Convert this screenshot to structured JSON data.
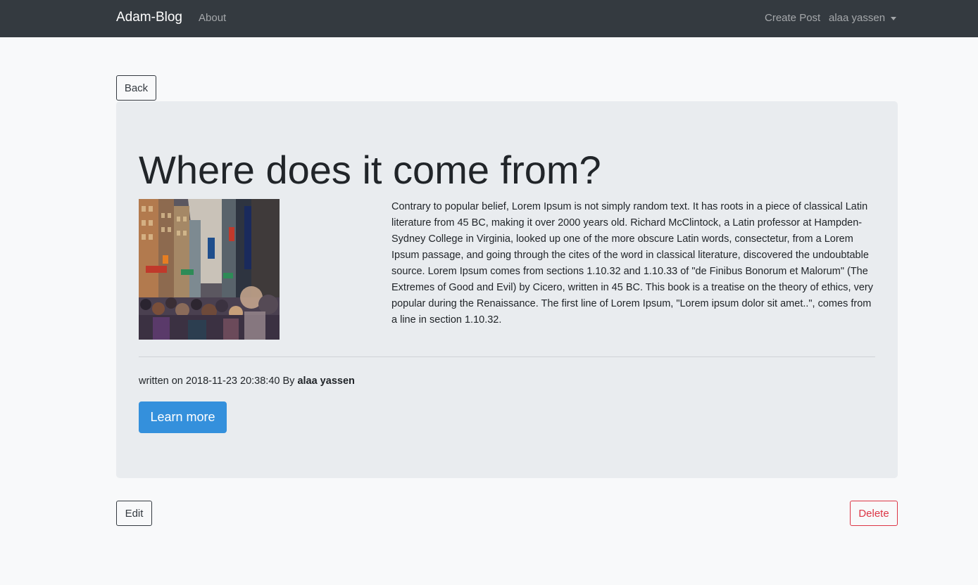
{
  "navbar": {
    "brand": "Adam-Blog",
    "about": "About",
    "create_post": "Create Post",
    "user": "alaa yassen"
  },
  "buttons": {
    "back": "Back",
    "edit": "Edit",
    "delete": "Delete",
    "learn_more": "Learn more"
  },
  "post": {
    "title": "Where does it come from?",
    "image_icon": "city-street-crowd-photo",
    "body": "Contrary to popular belief, Lorem Ipsum is not simply random text. It has roots in a piece of classical Latin literature from 45 BC, making it over 2000 years old. Richard McClintock, a Latin professor at Hampden-Sydney College in Virginia, looked up one of the more obscure Latin words, consectetur, from a Lorem Ipsum passage, and going through the cites of the word in classical literature, discovered the undoubtable source. Lorem Ipsum comes from sections 1.10.32 and 1.10.33 of \"de Finibus Bonorum et Malorum\" (The Extremes of Good and Evil) by Cicero, written in 45 BC. This book is a treatise on the theory of ethics, very popular during the Renaissance. The first line of Lorem Ipsum, \"Lorem ipsum dolor sit amet..\", comes from a line in section 1.10.32.",
    "meta_prefix": "written on 2018-11-23 20:38:40 By ",
    "author": "alaa yassen"
  },
  "colors": {
    "navbar_bg": "#343a40",
    "page_bg": "#f8f9fa",
    "jumbotron_bg": "#e9ecef",
    "primary": "#3490dc",
    "danger": "#dc3545"
  }
}
